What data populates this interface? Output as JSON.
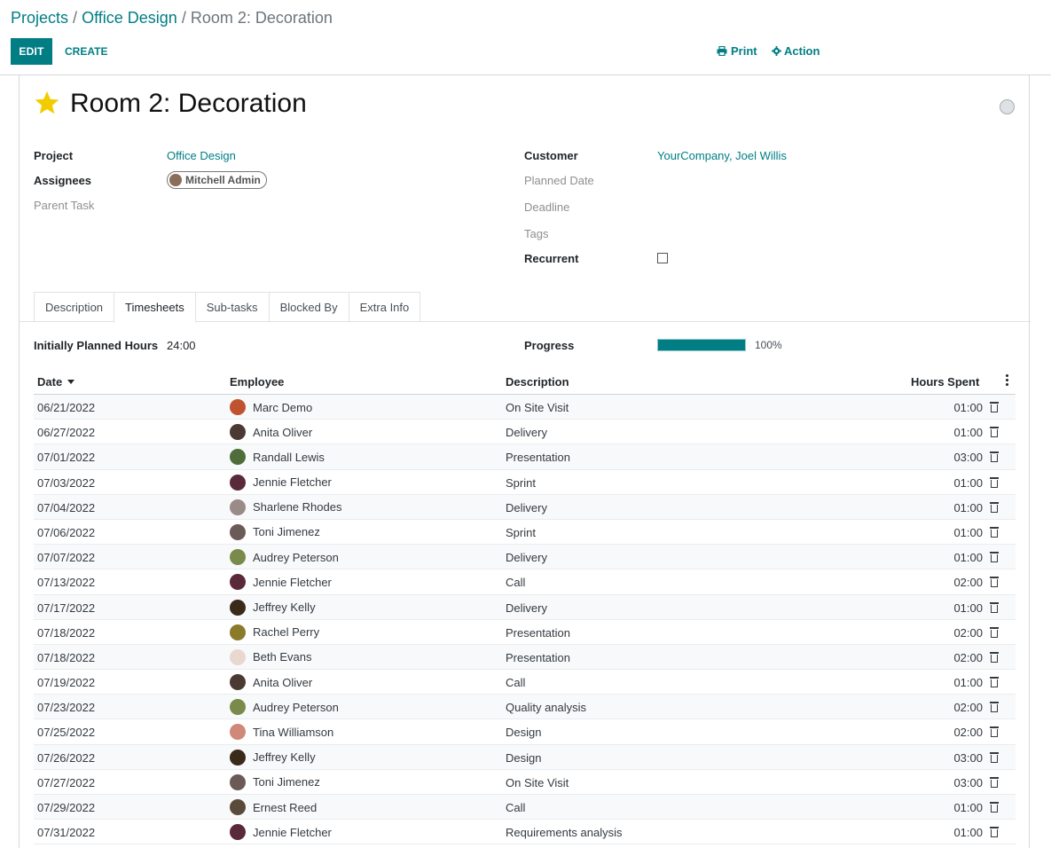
{
  "breadcrumb": {
    "root": "Projects",
    "sep1": "/",
    "project": "Office Design",
    "sep2": "/",
    "current": "Room 2: Decoration"
  },
  "toolbar": {
    "edit_label": "EDIT",
    "create_label": "CREATE",
    "print_label": "Print",
    "action_label": "Action"
  },
  "task": {
    "title": "Room 2: Decoration",
    "starred": true,
    "accent_color": "#017e84",
    "star_color": "#f3cc00"
  },
  "fields": {
    "project_label": "Project",
    "project_value": "Office Design",
    "assignees_label": "Assignees",
    "assignee_value": "Mitchell Admin",
    "parent_task_label": "Parent Task",
    "customer_label": "Customer",
    "customer_value": "YourCompany, Joel Willis",
    "planned_date_label": "Planned Date",
    "deadline_label": "Deadline",
    "tags_label": "Tags",
    "recurrent_label": "Recurrent",
    "recurrent_checked": false
  },
  "tabs": [
    {
      "label": "Description",
      "active": false
    },
    {
      "label": "Timesheets",
      "active": true
    },
    {
      "label": "Sub-tasks",
      "active": false
    },
    {
      "label": "Blocked By",
      "active": false
    },
    {
      "label": "Extra Info",
      "active": false
    }
  ],
  "timesheet": {
    "planned_label": "Initially Planned Hours",
    "planned_value": "24:00",
    "progress_label": "Progress",
    "progress_text": "100%",
    "progress_fraction": 1.0,
    "columns": {
      "date": "Date",
      "employee": "Employee",
      "description": "Description",
      "hours": "Hours Spent"
    },
    "rows": [
      {
        "date": "06/21/2022",
        "employee": "Marc Demo",
        "description": "On Site Visit",
        "hours": "01:00",
        "avatar_color": "#c0522f"
      },
      {
        "date": "06/27/2022",
        "employee": "Anita Oliver",
        "description": "Delivery",
        "hours": "01:00",
        "avatar_color": "#4a3a33"
      },
      {
        "date": "07/01/2022",
        "employee": "Randall Lewis",
        "description": "Presentation",
        "hours": "03:00",
        "avatar_color": "#4f6d3a"
      },
      {
        "date": "07/03/2022",
        "employee": "Jennie Fletcher",
        "description": "Sprint",
        "hours": "01:00",
        "avatar_color": "#5a2a3a"
      },
      {
        "date": "07/04/2022",
        "employee": "Sharlene Rhodes",
        "description": "Delivery",
        "hours": "01:00",
        "avatar_color": "#9a8a88"
      },
      {
        "date": "07/06/2022",
        "employee": "Toni Jimenez",
        "description": "Sprint",
        "hours": "01:00",
        "avatar_color": "#6a5a58"
      },
      {
        "date": "07/07/2022",
        "employee": "Audrey Peterson",
        "description": "Delivery",
        "hours": "01:00",
        "avatar_color": "#7a8a4a"
      },
      {
        "date": "07/13/2022",
        "employee": "Jennie Fletcher",
        "description": "Call",
        "hours": "02:00",
        "avatar_color": "#5a2a3a"
      },
      {
        "date": "07/17/2022",
        "employee": "Jeffrey Kelly",
        "description": "Delivery",
        "hours": "01:00",
        "avatar_color": "#3a2a1a"
      },
      {
        "date": "07/18/2022",
        "employee": "Rachel Perry",
        "description": "Presentation",
        "hours": "02:00",
        "avatar_color": "#8a7a2a"
      },
      {
        "date": "07/18/2022",
        "employee": "Beth Evans",
        "description": "Presentation",
        "hours": "02:00",
        "avatar_color": "#e8d8d0"
      },
      {
        "date": "07/19/2022",
        "employee": "Anita Oliver",
        "description": "Call",
        "hours": "01:00",
        "avatar_color": "#4a3a33"
      },
      {
        "date": "07/23/2022",
        "employee": "Audrey Peterson",
        "description": "Quality analysis",
        "hours": "02:00",
        "avatar_color": "#7a8a4a"
      },
      {
        "date": "07/25/2022",
        "employee": "Tina Williamson",
        "description": "Design",
        "hours": "02:00",
        "avatar_color": "#d08878"
      },
      {
        "date": "07/26/2022",
        "employee": "Jeffrey Kelly",
        "description": "Design",
        "hours": "03:00",
        "avatar_color": "#3a2a1a"
      },
      {
        "date": "07/27/2022",
        "employee": "Toni Jimenez",
        "description": "On Site Visit",
        "hours": "03:00",
        "avatar_color": "#6a5a58"
      },
      {
        "date": "07/29/2022",
        "employee": "Ernest Reed",
        "description": "Call",
        "hours": "01:00",
        "avatar_color": "#5a4a3a"
      },
      {
        "date": "07/31/2022",
        "employee": "Jennie Fletcher",
        "description": "Requirements analysis",
        "hours": "01:00",
        "avatar_color": "#5a2a3a"
      }
    ]
  }
}
